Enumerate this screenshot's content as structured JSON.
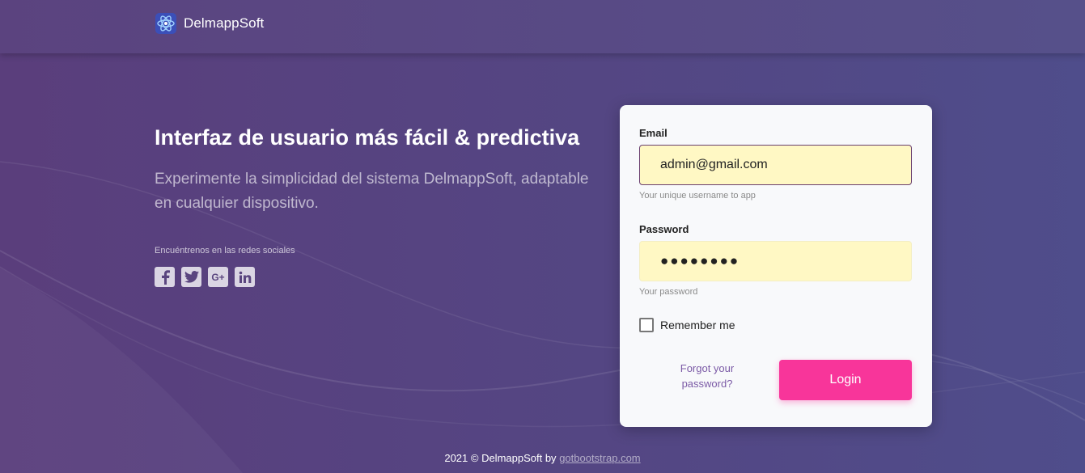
{
  "brand": {
    "name": "DelmappSoft",
    "logo_icon": "atom-icon"
  },
  "hero": {
    "title": "Interfaz de usuario más fácil & predictiva",
    "subtitle": "Experimente la simplicidad del sistema DelmappSoft, adaptable en cualquier dispositivo."
  },
  "social": {
    "label": "Encuéntrenos en las redes sociales",
    "icons": [
      "facebook-icon",
      "twitter-icon",
      "google-plus-icon",
      "linkedin-icon"
    ],
    "glyphs": {
      "google_plus": "G+"
    }
  },
  "login": {
    "email_label": "Email",
    "email_value": "admin@gmail.com",
    "email_help": "Your unique username to app",
    "password_label": "Password",
    "password_value": "●●●●●●●●",
    "password_help": "Your password",
    "remember_label": "Remember me",
    "forgot_label": "Forgot your password?",
    "login_label": "Login"
  },
  "footer": {
    "text": "2021 © DelmappSoft by",
    "link": "gotbootstrap.com"
  },
  "colors": {
    "background": "#56447f",
    "accent": "#f8359a",
    "link": "#7b5aa6",
    "input_fill": "#fff8c4"
  }
}
